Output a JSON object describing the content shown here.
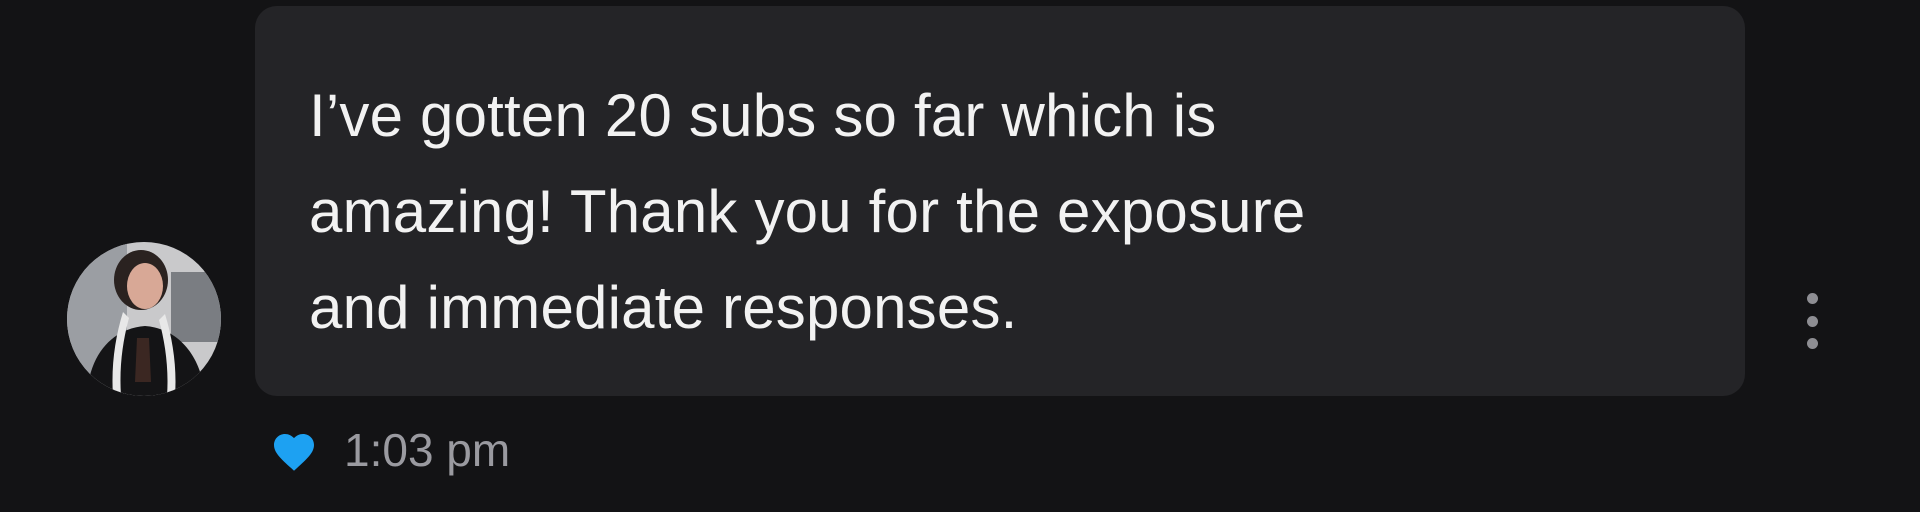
{
  "message": {
    "text": "I’ve gotten 20 subs so far which is\namazing! Thank you for the exposure\nand immediate responses.",
    "timestamp": "1:03 pm",
    "liked": true
  },
  "icons": {
    "like": "heart-icon",
    "more": "vertical-ellipsis-icon",
    "avatar": "user-avatar-photo"
  },
  "colors": {
    "background": "#131315",
    "bubble": "#242427",
    "message_text": "#f2f2f2",
    "timestamp_text": "#9a9aa0",
    "heart": "#1da1f2",
    "more_dots": "#8e8e93"
  }
}
